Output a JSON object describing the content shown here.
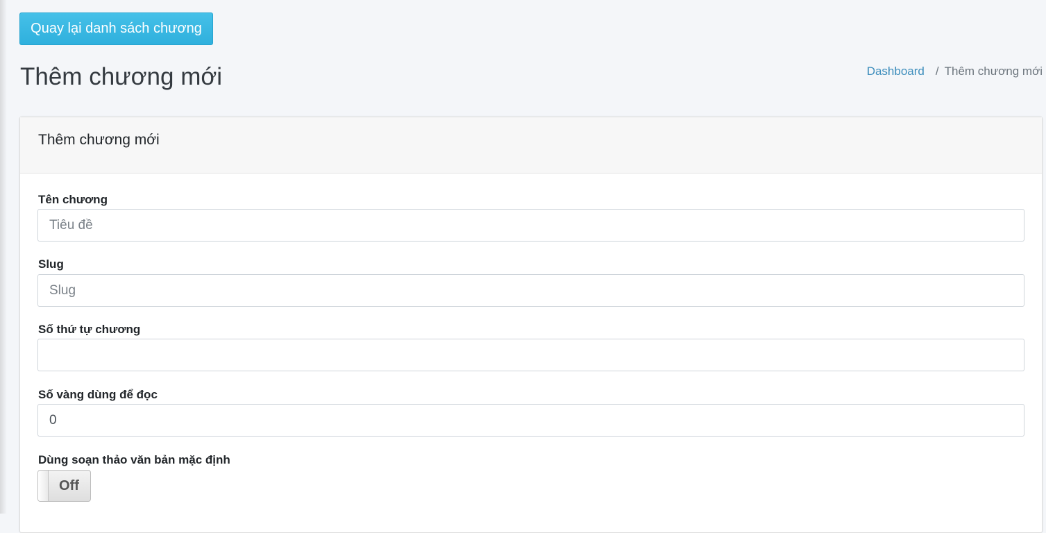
{
  "toolbar": {
    "back_label": "Quay lại danh sách chương"
  },
  "header": {
    "title": "Thêm chương mới",
    "breadcrumb": {
      "home": "Dashboard",
      "separator": "/",
      "current": "Thêm chương mới"
    }
  },
  "card": {
    "title": "Thêm chương mới"
  },
  "form": {
    "chapter_name": {
      "label": "Tên chương",
      "value": "",
      "placeholder": "Tiêu đề"
    },
    "slug": {
      "label": "Slug",
      "value": "",
      "placeholder": "Slug"
    },
    "chapter_order": {
      "label": "Số thứ tự chương",
      "value": "",
      "placeholder": ""
    },
    "gold_to_read": {
      "label": "Số vàng dùng để đọc",
      "value": "0",
      "placeholder": ""
    },
    "default_editor": {
      "label": "Dùng soạn thảo văn bản mặc định",
      "state": "Off"
    }
  },
  "colors": {
    "primary_button": "#33b5e0",
    "link": "#3c8dbc",
    "background": "#f4f6f9"
  }
}
